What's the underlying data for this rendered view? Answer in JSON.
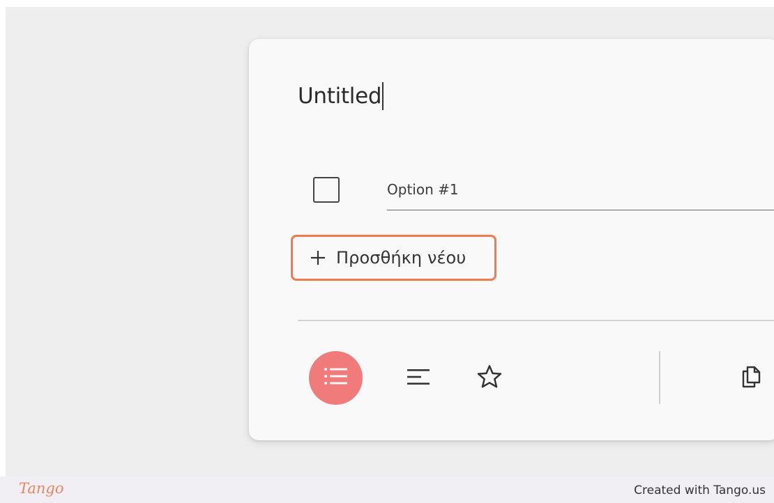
{
  "editor": {
    "title": "Untitled",
    "options": [
      {
        "label": "Option #1",
        "checked": false
      }
    ],
    "add_new_label": "Προσθήκη νέου",
    "highlight_color": "#f07a4c"
  },
  "toolbar": {
    "items": [
      {
        "icon": "bulleted-list-icon",
        "active": true,
        "active_color": "#f07b7a"
      },
      {
        "icon": "text-lines-icon",
        "active": false
      },
      {
        "icon": "star-icon",
        "active": false
      },
      {
        "icon": "duplicate-icon",
        "active": false
      }
    ]
  },
  "footer": {
    "logo_text": "Tango",
    "created_text": "Created with Tango.us"
  }
}
